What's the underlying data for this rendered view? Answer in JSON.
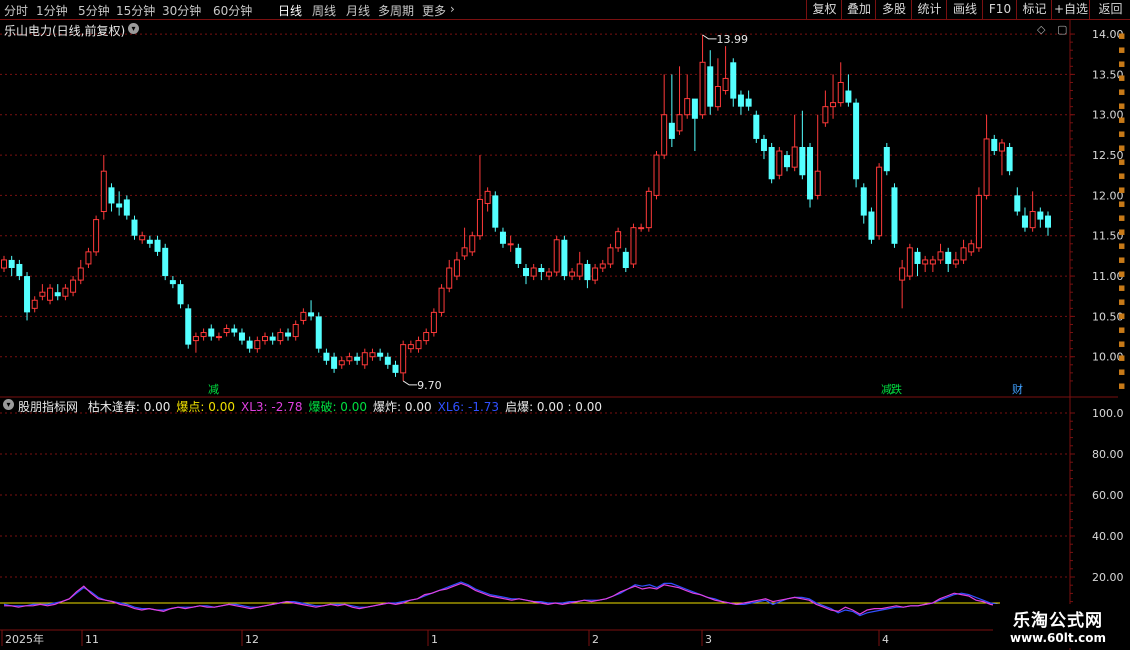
{
  "toolbar": {
    "periods": [
      {
        "label": "分时",
        "active": false
      },
      {
        "label": "1分钟",
        "active": false
      },
      {
        "label": "5分钟",
        "active": false
      },
      {
        "label": "15分钟",
        "active": false
      },
      {
        "label": "30分钟",
        "active": false
      },
      {
        "label": "60分钟",
        "active": false
      },
      {
        "label": "日线",
        "active": true
      },
      {
        "label": "周线",
        "active": false
      },
      {
        "label": "月线",
        "active": false
      },
      {
        "label": "多周期",
        "active": false
      },
      {
        "label": "更多",
        "active": false
      }
    ],
    "more_arrow": "›",
    "buttons": [
      "复权",
      "叠加",
      "多股",
      "统计",
      "画线",
      "F10",
      "标记",
      "+自选",
      "返回"
    ]
  },
  "stock": {
    "title": "乐山电力(日线,前复权)",
    "dropdown_icon": "chevron-down-icon"
  },
  "price_axis": {
    "ticks": [
      "14.00",
      "13.50",
      "13.00",
      "12.50",
      "12.00",
      "11.50",
      "11.00",
      "10.50",
      "10.00"
    ],
    "high_label": "13.99",
    "low_label": "9.70"
  },
  "indicator": {
    "name": "股朋指标网",
    "items": [
      {
        "label": "枯木逢春: 0.00",
        "color": "#e8e8e8"
      },
      {
        "label": "爆点: 0.00",
        "color": "#f0e000"
      },
      {
        "label": "XL3: -2.78",
        "color": "#e040e0"
      },
      {
        "label": "爆破: 0.00",
        "color": "#00e040"
      },
      {
        "label": "爆炸: 0.00",
        "color": "#e8e8e8"
      },
      {
        "label": "XL6: -1.73",
        "color": "#3050ff"
      },
      {
        "label": "启爆: 0.00 : 0.00",
        "color": "#e8e8e8"
      }
    ],
    "ticks": [
      "100.0",
      "80.00",
      "60.00",
      "40.00",
      "20.00"
    ]
  },
  "event_tags": [
    {
      "label": "减",
      "color": "#00e040"
    },
    {
      "label": "减",
      "color": "#00e040"
    },
    {
      "label": "跌",
      "color": "#00e040"
    },
    {
      "label": "财",
      "color": "#40a0ff"
    }
  ],
  "time_axis": {
    "labels": [
      "2025年",
      "11",
      "12",
      "1",
      "2",
      "3",
      "4"
    ]
  },
  "watermark": {
    "line1": "乐淘公式网",
    "line2": "www.60lt.com"
  },
  "colors": {
    "up": "#ff3a3a",
    "down": "#54ffff",
    "grid": "#7a1010",
    "axis_text": "#d8d8d8",
    "line_xl3": "#e040e0",
    "line_xl6": "#3050ff",
    "zero_line": "#f0e000"
  },
  "chart_data": {
    "type": "candlestick",
    "title": "乐山电力(日线,前复权)",
    "ylim": [
      9.6,
      14.1
    ],
    "candles": [
      [
        11.1,
        11.2,
        11.25,
        11.05
      ],
      [
        11.2,
        11.1,
        11.25,
        11.0
      ],
      [
        11.15,
        11.0,
        11.2,
        10.95
      ],
      [
        11.0,
        10.55,
        11.05,
        10.45
      ],
      [
        10.6,
        10.7,
        10.75,
        10.55
      ],
      [
        10.75,
        10.8,
        10.9,
        10.7
      ],
      [
        10.7,
        10.85,
        10.9,
        10.65
      ],
      [
        10.8,
        10.75,
        10.9,
        10.7
      ],
      [
        10.75,
        10.85,
        10.9,
        10.7
      ],
      [
        10.8,
        10.95,
        11.0,
        10.75
      ],
      [
        10.95,
        11.1,
        11.2,
        10.9
      ],
      [
        11.15,
        11.3,
        11.35,
        11.1
      ],
      [
        11.3,
        11.7,
        11.75,
        11.25
      ],
      [
        11.8,
        12.3,
        12.5,
        11.7
      ],
      [
        12.1,
        11.9,
        12.15,
        11.8
      ],
      [
        11.9,
        11.85,
        12.05,
        11.75
      ],
      [
        11.95,
        11.75,
        12.0,
        11.7
      ],
      [
        11.7,
        11.5,
        11.75,
        11.45
      ],
      [
        11.45,
        11.5,
        11.55,
        11.4
      ],
      [
        11.45,
        11.4,
        11.5,
        11.35
      ],
      [
        11.45,
        11.3,
        11.5,
        11.25
      ],
      [
        11.35,
        11.0,
        11.4,
        10.95
      ],
      [
        10.95,
        10.9,
        11.0,
        10.85
      ],
      [
        10.9,
        10.65,
        10.95,
        10.6
      ],
      [
        10.6,
        10.15,
        10.65,
        10.1
      ],
      [
        10.2,
        10.25,
        10.3,
        10.05
      ],
      [
        10.25,
        10.3,
        10.35,
        10.2
      ],
      [
        10.35,
        10.25,
        10.4,
        10.2
      ],
      [
        10.25,
        10.25,
        10.3,
        10.2
      ],
      [
        10.3,
        10.35,
        10.4,
        10.25
      ],
      [
        10.35,
        10.3,
        10.4,
        10.25
      ],
      [
        10.3,
        10.2,
        10.35,
        10.15
      ],
      [
        10.2,
        10.1,
        10.25,
        10.05
      ],
      [
        10.1,
        10.2,
        10.25,
        10.05
      ],
      [
        10.2,
        10.25,
        10.3,
        10.15
      ],
      [
        10.25,
        10.2,
        10.3,
        10.15
      ],
      [
        10.2,
        10.3,
        10.35,
        10.15
      ],
      [
        10.3,
        10.25,
        10.35,
        10.2
      ],
      [
        10.25,
        10.4,
        10.45,
        10.2
      ],
      [
        10.45,
        10.55,
        10.6,
        10.4
      ],
      [
        10.55,
        10.5,
        10.7,
        10.45
      ],
      [
        10.5,
        10.1,
        10.55,
        10.05
      ],
      [
        10.05,
        9.95,
        10.1,
        9.9
      ],
      [
        10.0,
        9.85,
        10.05,
        9.8
      ],
      [
        9.9,
        9.95,
        10.0,
        9.85
      ],
      [
        9.95,
        10.0,
        10.05,
        9.9
      ],
      [
        10.0,
        9.95,
        10.05,
        9.9
      ],
      [
        9.9,
        10.05,
        10.1,
        9.85
      ],
      [
        10.0,
        10.05,
        10.1,
        9.95
      ],
      [
        10.05,
        10.0,
        10.1,
        9.95
      ],
      [
        10.0,
        9.9,
        10.05,
        9.85
      ],
      [
        9.9,
        9.8,
        9.95,
        9.75
      ],
      [
        9.8,
        10.15,
        10.2,
        9.7
      ],
      [
        10.1,
        10.15,
        10.2,
        10.05
      ],
      [
        10.1,
        10.2,
        10.25,
        10.05
      ],
      [
        10.2,
        10.3,
        10.35,
        10.15
      ],
      [
        10.3,
        10.55,
        10.6,
        10.25
      ],
      [
        10.55,
        10.85,
        10.9,
        10.5
      ],
      [
        10.85,
        11.1,
        11.2,
        10.8
      ],
      [
        11.0,
        11.2,
        11.3,
        10.95
      ],
      [
        11.25,
        11.35,
        11.6,
        11.2
      ],
      [
        11.3,
        11.5,
        11.55,
        11.25
      ],
      [
        11.5,
        11.95,
        12.5,
        11.45
      ],
      [
        11.9,
        12.05,
        12.1,
        11.8
      ],
      [
        12.0,
        11.6,
        12.05,
        11.55
      ],
      [
        11.55,
        11.4,
        11.6,
        11.35
      ],
      [
        11.4,
        11.4,
        11.5,
        11.3
      ],
      [
        11.35,
        11.15,
        11.4,
        11.1
      ],
      [
        11.1,
        11.0,
        11.15,
        10.9
      ],
      [
        11.0,
        11.1,
        11.15,
        10.95
      ],
      [
        11.1,
        11.05,
        11.15,
        10.95
      ],
      [
        11.0,
        11.05,
        11.1,
        10.95
      ],
      [
        11.05,
        11.45,
        11.5,
        11.0
      ],
      [
        11.45,
        11.0,
        11.5,
        10.95
      ],
      [
        11.0,
        11.05,
        11.1,
        10.95
      ],
      [
        11.0,
        11.15,
        11.3,
        10.95
      ],
      [
        11.15,
        10.95,
        11.2,
        10.85
      ],
      [
        10.95,
        11.1,
        11.15,
        10.9
      ],
      [
        11.1,
        11.15,
        11.2,
        11.05
      ],
      [
        11.15,
        11.35,
        11.4,
        11.1
      ],
      [
        11.35,
        11.55,
        11.6,
        11.3
      ],
      [
        11.3,
        11.1,
        11.35,
        11.05
      ],
      [
        11.15,
        11.6,
        11.65,
        11.1
      ],
      [
        11.6,
        11.6,
        11.65,
        11.55
      ],
      [
        11.6,
        12.05,
        12.1,
        11.55
      ],
      [
        12.0,
        12.5,
        12.55,
        11.95
      ],
      [
        12.5,
        13.0,
        13.5,
        12.45
      ],
      [
        12.9,
        12.7,
        13.5,
        12.6
      ],
      [
        12.8,
        13.0,
        13.6,
        12.75
      ],
      [
        13.0,
        13.2,
        13.5,
        12.95
      ],
      [
        13.2,
        12.95,
        13.1,
        12.55
      ],
      [
        13.0,
        13.65,
        13.99,
        12.95
      ],
      [
        13.6,
        13.1,
        13.8,
        13.0
      ],
      [
        13.1,
        13.35,
        13.7,
        13.05
      ],
      [
        13.3,
        13.45,
        13.85,
        13.25
      ],
      [
        13.65,
        13.2,
        13.7,
        13.1
      ],
      [
        13.25,
        13.1,
        13.3,
        13.0
      ],
      [
        13.2,
        13.1,
        13.3,
        13.05
      ],
      [
        13.0,
        12.7,
        13.05,
        12.65
      ],
      [
        12.7,
        12.55,
        12.75,
        12.45
      ],
      [
        12.6,
        12.2,
        12.65,
        12.15
      ],
      [
        12.25,
        12.55,
        12.6,
        12.2
      ],
      [
        12.5,
        12.35,
        12.55,
        12.3
      ],
      [
        12.35,
        12.6,
        13.0,
        12.3
      ],
      [
        12.6,
        12.25,
        13.05,
        12.2
      ],
      [
        12.6,
        11.95,
        12.65,
        11.85
      ],
      [
        12.0,
        12.3,
        13.0,
        11.95
      ],
      [
        12.9,
        13.1,
        13.3,
        12.85
      ],
      [
        13.1,
        13.15,
        13.5,
        12.95
      ],
      [
        13.15,
        13.4,
        13.65,
        13.1
      ],
      [
        13.3,
        13.15,
        13.5,
        13.1
      ],
      [
        13.15,
        12.2,
        13.2,
        12.1
      ],
      [
        12.1,
        11.75,
        12.15,
        11.65
      ],
      [
        11.8,
        11.45,
        11.85,
        11.4
      ],
      [
        11.5,
        12.35,
        12.4,
        11.45
      ],
      [
        12.6,
        12.3,
        12.65,
        12.25
      ],
      [
        12.1,
        11.4,
        12.15,
        11.35
      ],
      [
        10.95,
        11.1,
        11.2,
        10.6
      ],
      [
        11.0,
        11.35,
        11.4,
        10.95
      ],
      [
        11.3,
        11.15,
        11.35,
        11.0
      ],
      [
        11.15,
        11.2,
        11.25,
        11.05
      ],
      [
        11.15,
        11.2,
        11.25,
        11.05
      ],
      [
        11.2,
        11.3,
        11.4,
        11.15
      ],
      [
        11.3,
        11.15,
        11.35,
        11.05
      ],
      [
        11.15,
        11.2,
        11.3,
        11.1
      ],
      [
        11.2,
        11.35,
        11.45,
        11.15
      ],
      [
        11.3,
        11.4,
        11.45,
        11.25
      ],
      [
        11.35,
        12.0,
        12.1,
        11.3
      ],
      [
        12.0,
        12.7,
        13.0,
        11.95
      ],
      [
        12.7,
        12.55,
        12.75,
        12.5
      ],
      [
        12.55,
        12.65,
        12.7,
        12.25
      ],
      [
        12.6,
        12.3,
        12.65,
        12.25
      ],
      [
        12.0,
        11.8,
        12.1,
        11.75
      ],
      [
        11.75,
        11.6,
        11.85,
        11.55
      ],
      [
        11.6,
        11.8,
        12.05,
        11.55
      ],
      [
        11.8,
        11.7,
        11.85,
        11.6
      ],
      [
        11.75,
        11.6,
        11.8,
        11.5
      ]
    ],
    "xl3": [
      -2,
      -2,
      -3,
      -2,
      -2,
      -1,
      -2,
      -1,
      1,
      3,
      8,
      12,
      7,
      3,
      2,
      1,
      -1,
      -2,
      -4,
      -5,
      -4,
      -5,
      -6,
      -4,
      -3,
      -4,
      -3,
      -2,
      -3,
      -3,
      -2,
      -1,
      -2,
      -3,
      -4,
      -3,
      -2,
      -1,
      0,
      1,
      0,
      -1,
      -2,
      -3,
      -2,
      -1,
      -2,
      -1,
      -3,
      -4,
      -3,
      -2,
      -1,
      0,
      -1,
      0,
      2,
      3,
      6,
      7,
      9,
      10,
      12,
      14,
      12,
      9,
      7,
      5,
      4,
      3,
      2,
      3,
      2,
      1,
      0,
      -1,
      0,
      -1,
      0,
      1,
      2,
      1,
      2,
      3,
      5,
      8,
      10,
      12,
      10,
      11,
      10,
      13,
      12,
      11,
      9,
      7,
      6,
      4,
      2,
      1,
      0,
      -1,
      0,
      1,
      2,
      3,
      1,
      2,
      3,
      4,
      3,
      2,
      -1,
      -3,
      -5,
      -6,
      -3,
      -5,
      -8,
      -5,
      -4,
      -4,
      -3,
      -2,
      -3,
      -2,
      -2,
      -1,
      0,
      3,
      5,
      7,
      6,
      5,
      2,
      1,
      -1,
      -2,
      -3
    ],
    "xl6": [
      -1,
      -2,
      -2,
      -2,
      -1,
      -1,
      -1,
      0,
      1,
      3,
      7,
      11,
      8,
      4,
      2,
      1,
      0,
      -1,
      -3,
      -4,
      -4,
      -5,
      -5,
      -4,
      -3,
      -3,
      -3,
      -2,
      -2,
      -3,
      -2,
      -1,
      -1,
      -2,
      -3,
      -3,
      -2,
      -1,
      0,
      1,
      1,
      0,
      -1,
      -2,
      -2,
      -1,
      -1,
      -1,
      -2,
      -3,
      -3,
      -2,
      -1,
      0,
      0,
      1,
      2,
      3,
      5,
      7,
      9,
      11,
      13,
      15,
      13,
      10,
      8,
      6,
      5,
      4,
      3,
      3,
      2,
      1,
      1,
      0,
      0,
      0,
      1,
      1,
      2,
      2,
      2,
      3,
      5,
      7,
      10,
      13,
      12,
      13,
      11,
      14,
      14,
      12,
      10,
      8,
      6,
      4,
      3,
      1,
      0,
      -1,
      -1,
      0,
      1,
      2,
      -1,
      1,
      3,
      4,
      4,
      3,
      0,
      -2,
      -4,
      -7,
      -5,
      -6,
      -9,
      -7,
      -6,
      -5,
      -4,
      -3,
      -3,
      -2,
      -2,
      -1,
      0,
      2,
      4,
      6,
      7,
      6,
      4,
      2,
      0,
      -1,
      -2
    ]
  }
}
